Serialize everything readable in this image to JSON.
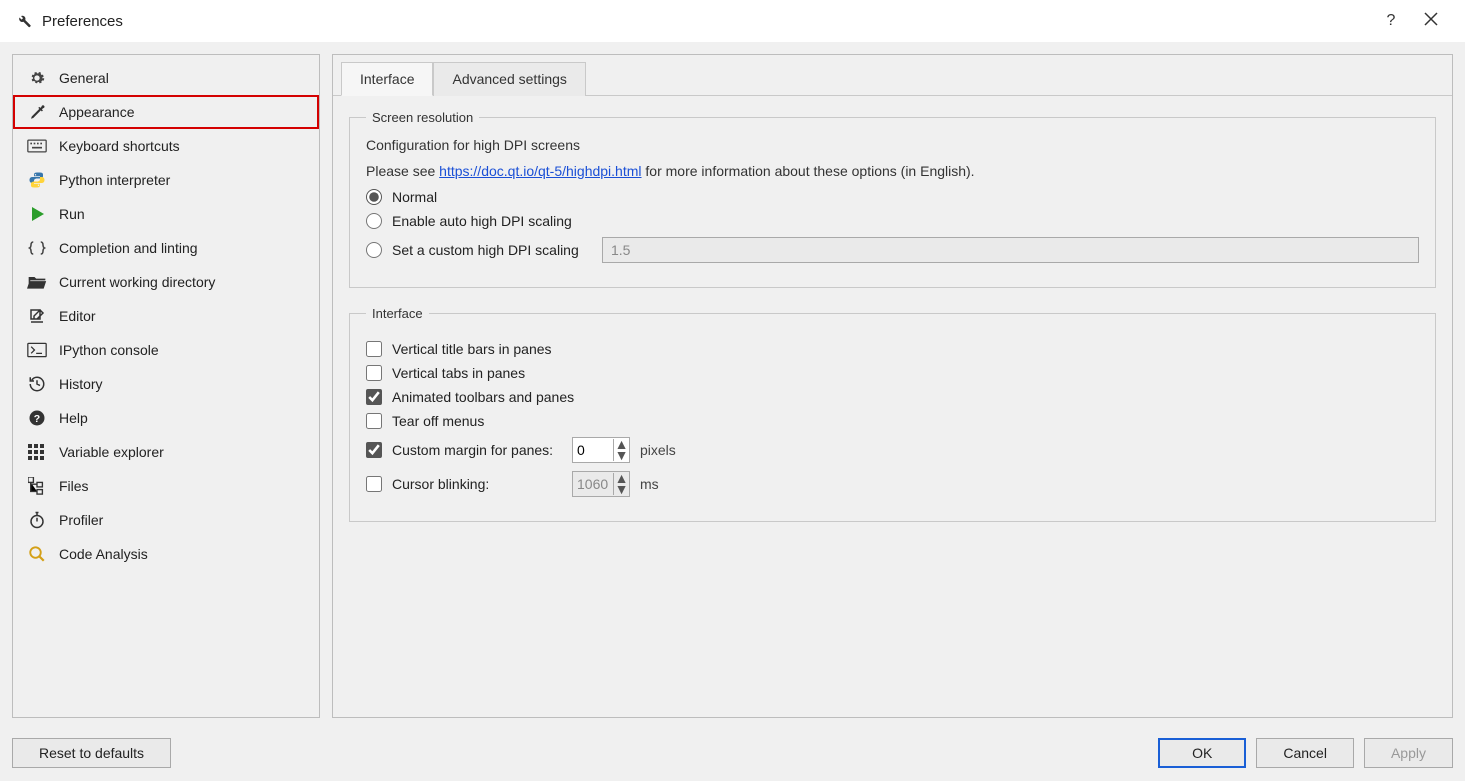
{
  "window": {
    "title": "Preferences"
  },
  "sidebar": {
    "items": [
      {
        "label": "General"
      },
      {
        "label": "Appearance"
      },
      {
        "label": "Keyboard shortcuts"
      },
      {
        "label": "Python interpreter"
      },
      {
        "label": "Run"
      },
      {
        "label": "Completion and linting"
      },
      {
        "label": "Current working directory"
      },
      {
        "label": "Editor"
      },
      {
        "label": "IPython console"
      },
      {
        "label": "History"
      },
      {
        "label": "Help"
      },
      {
        "label": "Variable explorer"
      },
      {
        "label": "Files"
      },
      {
        "label": "Profiler"
      },
      {
        "label": "Code Analysis"
      }
    ]
  },
  "tabs": {
    "interface": "Interface",
    "advanced": "Advanced settings"
  },
  "screen_res": {
    "legend": "Screen resolution",
    "config_line": "Configuration for high DPI screens",
    "please_see": "Please see ",
    "link": "https://doc.qt.io/qt-5/highdpi.html",
    "after_link": " for more information about these options (in English).",
    "opt_normal": "Normal",
    "opt_auto": "Enable auto high DPI scaling",
    "opt_custom": "Set a custom high DPI scaling",
    "custom_value": "1.5"
  },
  "iface": {
    "legend": "Interface",
    "vertical_title": "Vertical title bars in panes",
    "vertical_tabs": "Vertical tabs in panes",
    "animated": "Animated toolbars and panes",
    "tear_off": "Tear off menus",
    "custom_margin": "Custom margin for panes:",
    "margin_value": "0",
    "margin_unit": "pixels",
    "cursor_blink": "Cursor blinking:",
    "blink_value": "1060",
    "blink_unit": "ms"
  },
  "footer": {
    "reset": "Reset to defaults",
    "ok": "OK",
    "cancel": "Cancel",
    "apply": "Apply"
  }
}
